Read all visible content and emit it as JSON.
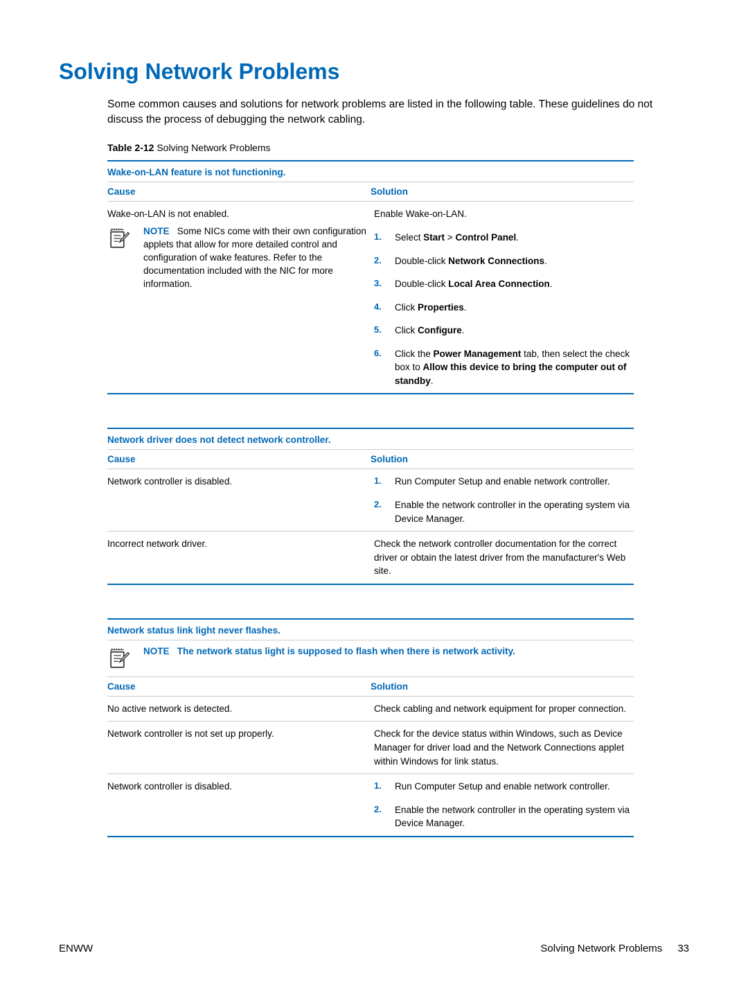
{
  "heading": "Solving Network Problems",
  "intro": "Some common causes and solutions for network problems are listed in the following table. These guidelines do not discuss the process of debugging the network cabling.",
  "table_label_prefix": "Table 2-12",
  "table_label_rest": "  Solving Network Problems",
  "cause_header": "Cause",
  "solution_header": "Solution",
  "table1": {
    "caption": "Wake-on-LAN feature is not functioning.",
    "cause_line": "Wake-on-LAN is not enabled.",
    "note_word": "NOTE",
    "note_text": "Some NICs come with their own configuration applets that allow for more detailed control and configuration of wake features. Refer to the documentation included with the NIC for more information.",
    "solution_line": "Enable Wake-on-LAN.",
    "steps": [
      {
        "n": "1.",
        "pre": "Select ",
        "b1": "Start",
        "mid": " > ",
        "b2": "Control Panel",
        "post": "."
      },
      {
        "n": "2.",
        "pre": "Double-click ",
        "b1": "Network Connections",
        "post": "."
      },
      {
        "n": "3.",
        "pre": "Double-click ",
        "b1": "Local Area Connection",
        "post": "."
      },
      {
        "n": "4.",
        "pre": "Click ",
        "b1": "Properties",
        "post": "."
      },
      {
        "n": "5.",
        "pre": "Click ",
        "b1": "Configure",
        "post": "."
      },
      {
        "n": "6.",
        "pre": "Click the ",
        "b1": "Power Management",
        "mid": " tab, then select the check box to ",
        "b2": "Allow this device to bring the computer out of standby",
        "post": "."
      }
    ]
  },
  "table2": {
    "caption": "Network driver does not detect network controller.",
    "rows": [
      {
        "cause": "Network controller is disabled.",
        "steps": [
          {
            "n": "1.",
            "text": "Run Computer Setup and enable network controller."
          },
          {
            "n": "2.",
            "text": "Enable the network controller in the operating system via Device Manager."
          }
        ]
      },
      {
        "cause": "Incorrect network driver.",
        "solution_text": "Check the network controller documentation for the correct driver or obtain the latest driver from the manufacturer's Web site."
      }
    ]
  },
  "table3": {
    "caption": "Network status link light never flashes.",
    "note_word": "NOTE",
    "note_text": "The network status light is supposed to flash when there is network activity.",
    "rows": [
      {
        "cause": "No active network is detected.",
        "solution_text": "Check cabling and network equipment for proper connection."
      },
      {
        "cause": "Network controller is not set up properly.",
        "solution_text": "Check for the device status within Windows, such as Device Manager for driver load and the Network Connections applet within Windows for link status."
      },
      {
        "cause": "Network controller is disabled.",
        "steps": [
          {
            "n": "1.",
            "text": "Run Computer Setup and enable network controller."
          },
          {
            "n": "2.",
            "text": "Enable the network controller in the operating system via Device Manager."
          }
        ]
      }
    ]
  },
  "footer_left": "ENWW",
  "footer_section": "Solving Network Problems",
  "footer_page": "33"
}
